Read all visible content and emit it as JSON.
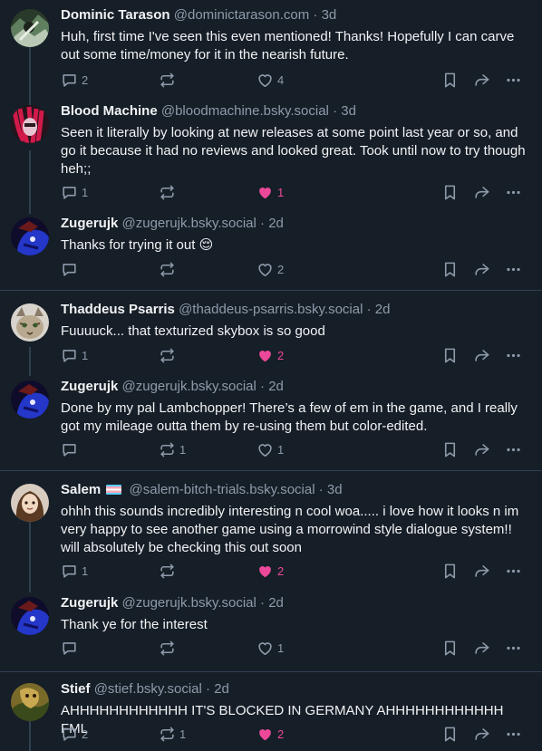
{
  "posts": [
    {
      "name": "Dominic Tarason",
      "handle": "@dominictarason.com",
      "time": "3d",
      "text": "Huh, first time I've seen this even mentioned! Thanks! Hopefully I can carve out some time/money for it in the nearish future.",
      "replies": "2",
      "reposts": "",
      "likes": "4",
      "liked": false
    },
    {
      "name": "Blood Machine",
      "handle": "@bloodmachine.bsky.social",
      "time": "3d",
      "text": "Seen it literally by looking at new releases at some point last year or so, and go it because it had no reviews and looked great. Took until now to try though heh;;",
      "replies": "1",
      "reposts": "",
      "likes": "1",
      "liked": true
    },
    {
      "name": "Zugerujk",
      "handle": "@zugerujk.bsky.social",
      "time": "2d",
      "text": "Thanks for trying it out 😌",
      "replies": "",
      "reposts": "",
      "likes": "2",
      "liked": false
    },
    {
      "name": "Thaddeus Psarris",
      "handle": "@thaddeus-psarris.bsky.social",
      "time": "2d",
      "text": "Fuuuuck... that texturized skybox is so good",
      "replies": "1",
      "reposts": "",
      "likes": "2",
      "liked": true
    },
    {
      "name": "Zugerujk",
      "handle": "@zugerujk.bsky.social",
      "time": "2d",
      "text": "Done by my pal Lambchopper! There’s a few of em in the game, and I really got my mileage outta them by re-using them but color-edited.",
      "replies": "",
      "reposts": "1",
      "likes": "1",
      "liked": false
    },
    {
      "name": "Salem",
      "handle": "@salem-bitch-trials.bsky.social",
      "time": "3d",
      "text": "ohhh this sounds incredibly interesting n cool woa..... i love how it looks n im very happy to see another game using a morrowind style dialogue system!! will absolutely be checking this out soon",
      "replies": "1",
      "reposts": "",
      "likes": "2",
      "liked": true
    },
    {
      "name": "Zugerujk",
      "handle": "@zugerujk.bsky.social",
      "time": "2d",
      "text": "Thank ye for the interest",
      "replies": "",
      "reposts": "",
      "likes": "1",
      "liked": false
    },
    {
      "name": "Stief",
      "handle": "@stief.bsky.social",
      "time": "2d",
      "text": "AHHHHHHHHHHHH IT'S BLOCKED IN GERMANY AHHHHHHHHHHHH FML",
      "replies": "2",
      "reposts": "1",
      "likes": "2",
      "liked": true
    }
  ],
  "icons": {
    "reply": "speech-bubble-icon",
    "repost": "repost-arrows-icon",
    "like": "heart-icon",
    "bookmark": "bookmark-icon",
    "share": "share-arrow-icon",
    "more": "more-dots-icon"
  },
  "colors": {
    "background": "#161e27",
    "separator": "#2e4052",
    "text_primary": "#f1f3f5",
    "text_secondary": "#8d9bab",
    "like_active": "#ec4899"
  }
}
